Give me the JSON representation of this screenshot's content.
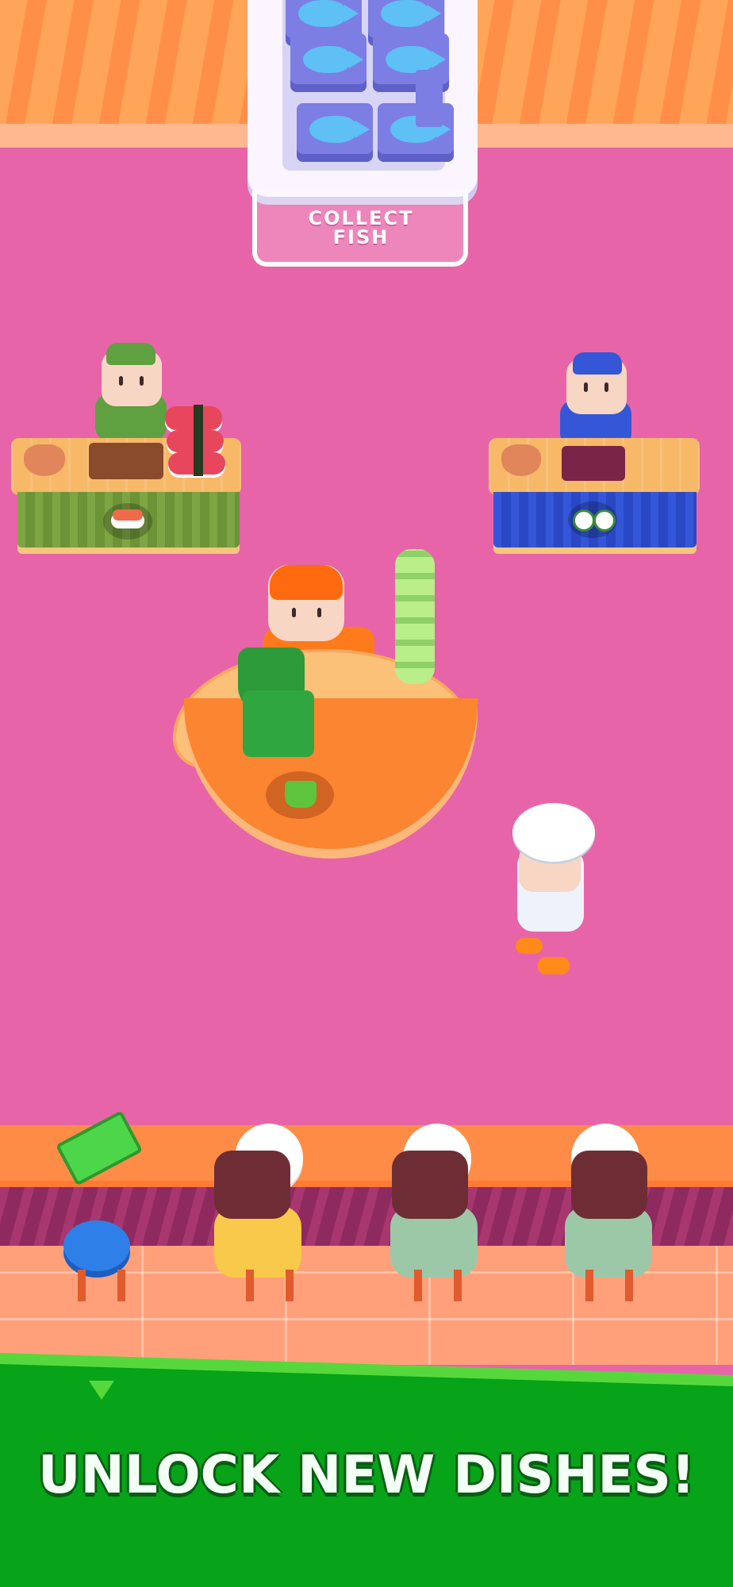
{
  "scene": {
    "collect_station": {
      "label": "COLLECT\nFISH"
    },
    "stations": [
      {
        "name": "Nigiri station",
        "worker_color": "#5fa040",
        "counter_color": "#7da544",
        "product_icon": "nigiri-icon"
      },
      {
        "name": "Maki station",
        "worker_color": "#3656d8",
        "counter_color": "#3456d8",
        "product_icon": "maki-roll-icon"
      },
      {
        "name": "Drink station",
        "worker_color": "#ff7a1a",
        "counter_color": "#fb8530",
        "product_icon": "green-cup-icon"
      }
    ],
    "customers": [
      {
        "shirt_color": "#f8c94a"
      },
      {
        "shirt_color": "#9cc8a8"
      },
      {
        "shirt_color": "#9cc8a8"
      }
    ],
    "cash_icon": "cash-stack-icon"
  },
  "banner": {
    "text": "UNLOCK NEW DISHES!"
  },
  "colors": {
    "floor": "#e864a8",
    "banner_green": "#07a318",
    "banner_stripe": "#56d83c"
  }
}
